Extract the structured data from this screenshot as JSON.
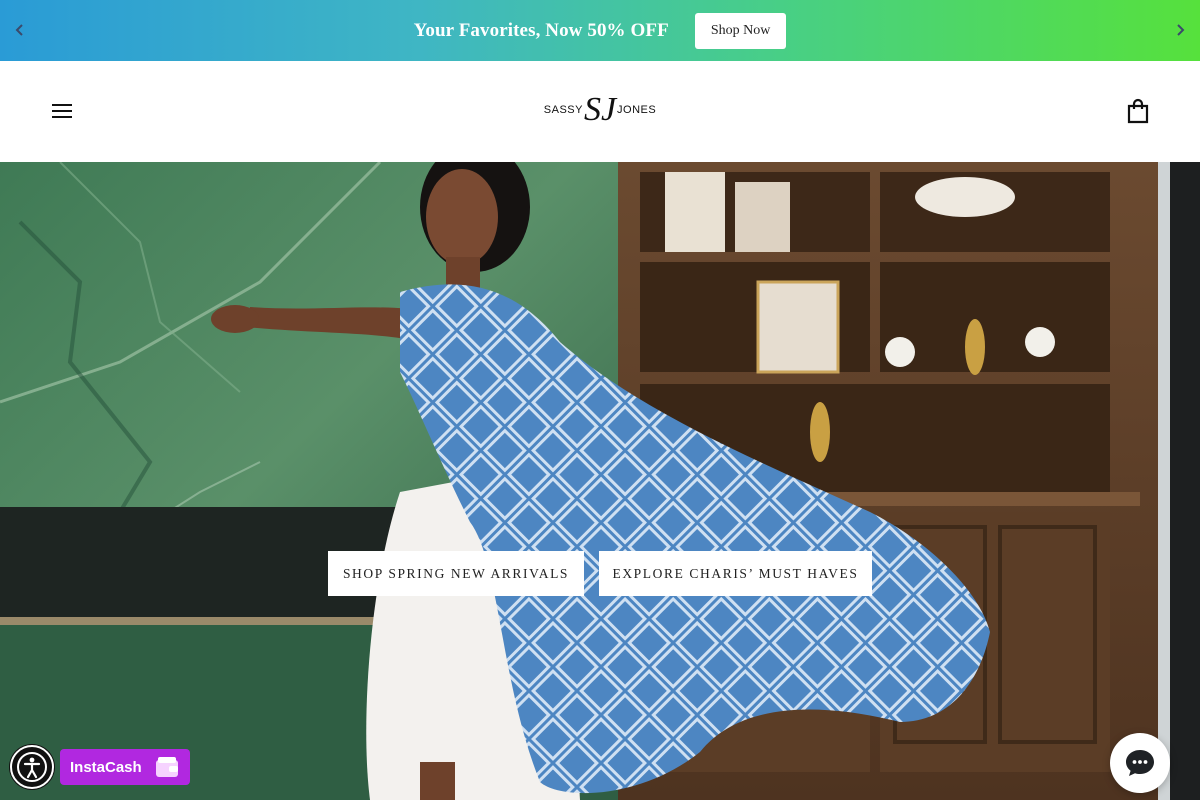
{
  "announcement": {
    "message": "Your Favorites, Now 50% OFF",
    "button_label": "Shop Now",
    "prev_icon": "chevron-left-icon",
    "next_icon": "chevron-right-icon",
    "gradient_start": "#2a9bd6",
    "gradient_end": "#56e13c"
  },
  "header": {
    "menu_icon": "hamburger-menu-icon",
    "logo": {
      "left_word": "SASSY",
      "monogram": "SJ",
      "right_word": "JONES"
    },
    "cart_icon": "shopping-bag-icon"
  },
  "hero": {
    "buttons": [
      {
        "label": "SHOP SPRING NEW ARRIVALS"
      },
      {
        "label": "EXPLORE CHARIS’ MUST HAVES"
      }
    ]
  },
  "widgets": {
    "accessibility_icon": "accessibility-icon",
    "instacash_label": "InstaCash",
    "instacash_color": "#b128e0",
    "wallet_icon": "wallet-icon",
    "chat_icon": "chat-bubble-icon"
  }
}
